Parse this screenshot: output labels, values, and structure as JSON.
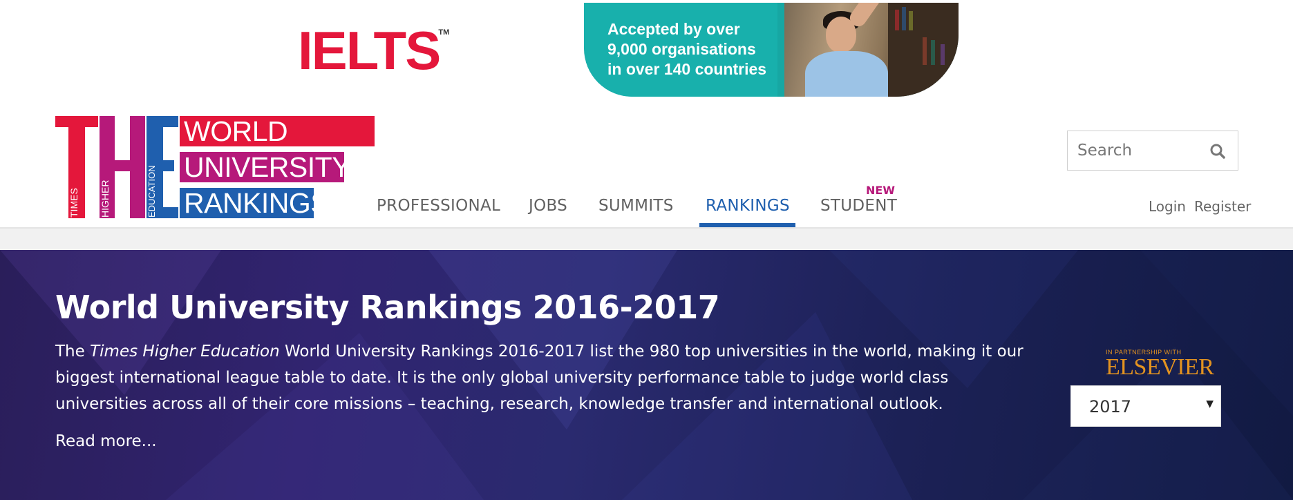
{
  "ad": {
    "brand": "IELTS",
    "brand_tm": "TM",
    "lines": [
      "Accepted by over",
      "9,000 organisations",
      "in over 140 countries"
    ]
  },
  "logo": {
    "letters": [
      "T",
      "H",
      "E"
    ],
    "vertical_words": [
      "TIMES",
      "HIGHER",
      "EDUCATION"
    ],
    "bars": [
      "WORLD",
      "UNIVERSITY",
      "RANKINGS"
    ],
    "colors": {
      "red": "#e4173b",
      "magenta": "#b6197a",
      "blue": "#1f5fae"
    }
  },
  "nav": {
    "items": [
      {
        "label": "PROFESSIONAL"
      },
      {
        "label": "JOBS"
      },
      {
        "label": "SUMMITS"
      },
      {
        "label": "RANKINGS",
        "active": true
      },
      {
        "label": "STUDENT",
        "badge": "NEW"
      }
    ],
    "login": "Login",
    "register": "Register"
  },
  "search": {
    "placeholder": "Search",
    "icon": "search-icon"
  },
  "hero": {
    "title": "World University Rankings 2016-2017",
    "desc_prefix": "The ",
    "desc_italic": "Times Higher Education",
    "desc_rest": " World University Rankings 2016-2017 list the 980 top universities in the world, making it our biggest international league table to date. It is the only global university performance table to judge world class universities across all of their core missions – teaching, research, knowledge transfer and international outlook.",
    "read_more": "Read more...",
    "partner_small": "IN PARTNERSHIP WITH",
    "partner_name": "ELSEVIER",
    "year_selected": "2017"
  }
}
